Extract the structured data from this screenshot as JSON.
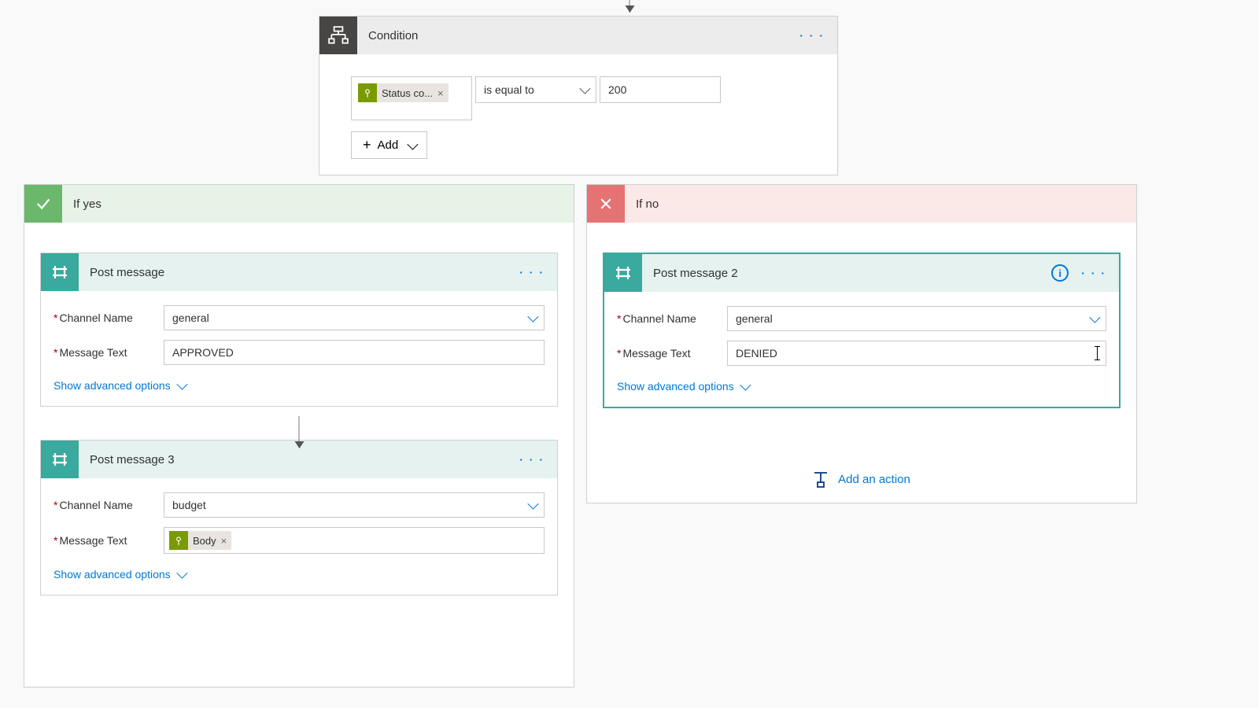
{
  "condition": {
    "title": "Condition",
    "token_label": "Status co...",
    "operator": "is equal to",
    "value": "200",
    "add_label": "Add"
  },
  "branches": {
    "yes": {
      "title": "If yes"
    },
    "no": {
      "title": "If no"
    }
  },
  "actions": {
    "post1": {
      "title": "Post message",
      "channel_label": "Channel Name",
      "channel_value": "general",
      "message_label": "Message Text",
      "message_value": "APPROVED",
      "adv": "Show advanced options"
    },
    "post3": {
      "title": "Post message 3",
      "channel_label": "Channel Name",
      "channel_value": "budget",
      "message_label": "Message Text",
      "body_chip": "Body",
      "adv": "Show advanced options"
    },
    "post2": {
      "title": "Post message 2",
      "channel_label": "Channel Name",
      "channel_value": "general",
      "message_label": "Message Text",
      "message_value": "DENIED",
      "adv": "Show advanced options"
    }
  },
  "add_action": "Add an action",
  "glyphs": {
    "ellipsis": "· · ·",
    "times": "×",
    "plus": "+"
  }
}
